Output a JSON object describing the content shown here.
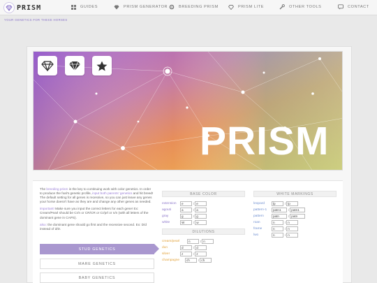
{
  "nav": {
    "logo_text": "PRISM",
    "items": [
      {
        "label": "GUIDES",
        "icon": "grid-icon"
      },
      {
        "label": "PRISM GENERATOR",
        "icon": "gem-icon"
      },
      {
        "label": "BREEDING PRISM",
        "icon": "gear-icon"
      },
      {
        "label": "PRISM LITE",
        "icon": "gem-outline-icon"
      },
      {
        "label": "OTHER TOOLS",
        "icon": "wrench-icon"
      },
      {
        "label": "CONTACT",
        "icon": "chat-icon"
      }
    ]
  },
  "sub_link": "YOUR GENETICS FOR THESE HORSES",
  "hero": {
    "title": "PRISM"
  },
  "intro": {
    "p1_a": "The ",
    "p1_b": "breeding prism",
    "p1_c": " is the key to continuing work with color genetics. In order to produce the foal's genetic profile, ",
    "p1_d": "input both parents' genetics",
    "p1_e": " and hit breed! The default setting for all genes is recessive, so you can just leave any genes your horse doesn't have as they are and change any other genes as needed.",
    "p2_a": "important!",
    "p2_b": " Make sure you input the correct letters for each gene! Ex: Cream/Pearl should be Cr/n or CR/CR or Cr/prl or n/n (with all letters of the dominant gene in CAPS).",
    "p3_a": "also:",
    "p3_b": " the dominant gene should go first and the recessive second. Ex: D/d instead of d/D."
  },
  "tabs": [
    "STUD GENETICS",
    "MARE GENETICS",
    "BABY GENETICS"
  ],
  "sections": {
    "base": "BASE COLOR",
    "dilutions": "DILUTIONS",
    "white": "WHITE MARKINGS"
  },
  "base_rows": [
    {
      "label": "extension",
      "a": "e",
      "b": "e"
    },
    {
      "label": "agouti",
      "a": "a",
      "b": "a"
    },
    {
      "label": "gray",
      "a": "g",
      "b": "g"
    },
    {
      "label": "white",
      "a": "W",
      "b": "w"
    }
  ],
  "dilution_rows": [
    {
      "label": "cream/pearl",
      "a": "n",
      "b": "n"
    },
    {
      "label": "dun",
      "a": "d",
      "b": "d"
    },
    {
      "label": "silver",
      "a": "z",
      "b": "z"
    },
    {
      "label": "champagne",
      "a": "ch",
      "b": "ch"
    }
  ],
  "white_rows": [
    {
      "label": "leopard",
      "a": "lp",
      "b": "lp"
    },
    {
      "label": "pattern-1",
      "a": "patn1",
      "b": "patn1"
    },
    {
      "label": "pattern",
      "a": "patn",
      "b": "patn"
    },
    {
      "label": "roan",
      "a": "n",
      "b": "n"
    },
    {
      "label": "frame",
      "a": "n",
      "b": "n"
    },
    {
      "label": "lwo",
      "a": "n",
      "b": "n"
    }
  ]
}
